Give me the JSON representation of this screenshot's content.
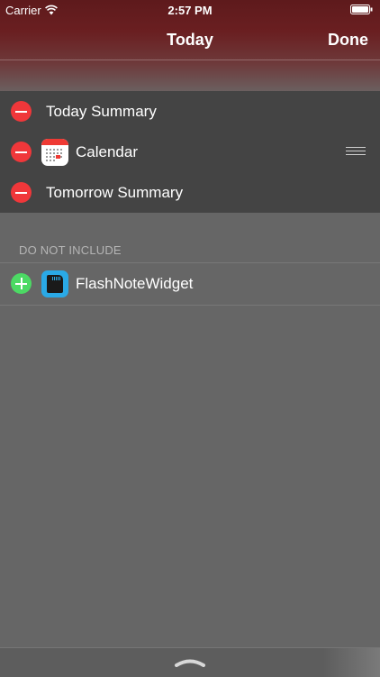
{
  "status_bar": {
    "carrier": "Carrier",
    "time": "2:57 PM",
    "wifi_icon": "wifi-icon",
    "battery_icon": "battery-icon"
  },
  "nav": {
    "title": "Today",
    "done_label": "Done"
  },
  "included": {
    "items": [
      {
        "label": "Today Summary",
        "action_icon": "remove-icon",
        "app_icon": ""
      },
      {
        "label": "Calendar",
        "action_icon": "remove-icon",
        "app_icon": "calendar-icon",
        "reorder_icon": "reorder-icon"
      },
      {
        "label": "Tomorrow Summary",
        "action_icon": "remove-icon",
        "app_icon": ""
      }
    ]
  },
  "excluded": {
    "header": "DO NOT INCLUDE",
    "items": [
      {
        "label": "FlashNoteWidget",
        "action_icon": "add-icon",
        "app_icon": "flashnote-icon"
      }
    ]
  },
  "bottom": {
    "grabber_icon": "chevron-up-icon"
  },
  "colors": {
    "remove": "#f0373a",
    "add": "#4cd964",
    "included_bg": "#444444",
    "background": "#666666",
    "header_red": "#6a1f21"
  }
}
